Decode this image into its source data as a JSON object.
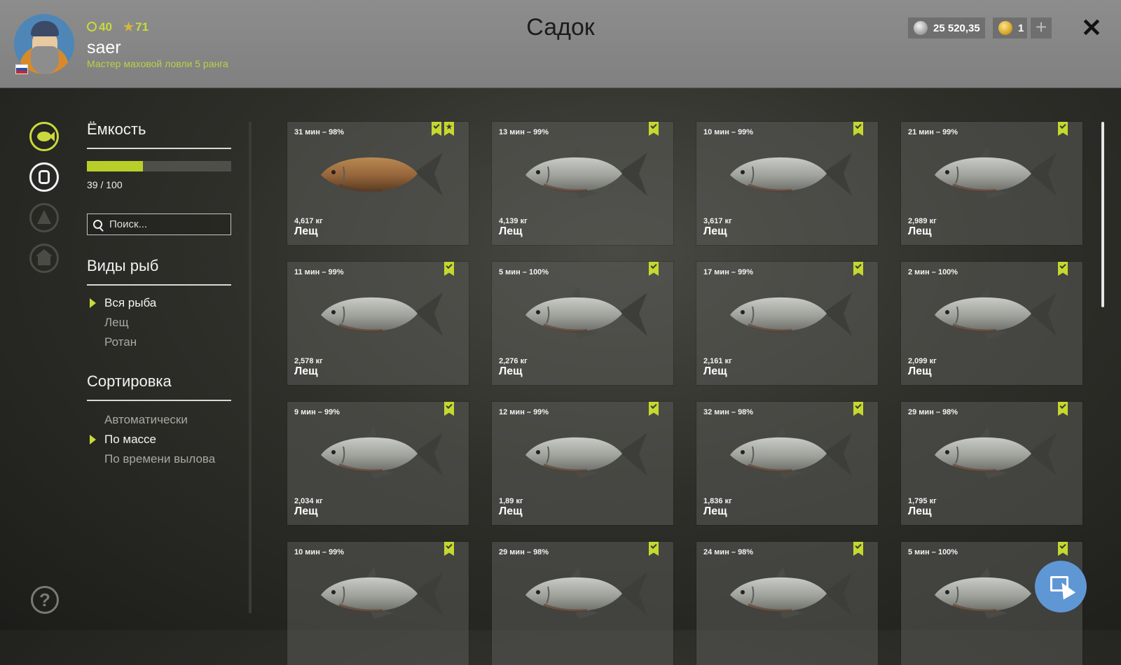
{
  "header": {
    "title": "Садок",
    "level": "40",
    "stars": "71",
    "username": "saer",
    "rank": "Мастер маховой ловли 5 ранга",
    "silver": "25 520,35",
    "gold": "1",
    "plus": "+",
    "close": "✕"
  },
  "colors": {
    "accent": "#c9da3a",
    "bookmark": "#c5d82f",
    "capacity_fill": "#b8cf2a",
    "cursor_button": "#5f97d4"
  },
  "capacity": {
    "title": "Ёмкость",
    "current": 39,
    "max": 100,
    "text": "39 / 100"
  },
  "search": {
    "placeholder": "Поиск..."
  },
  "species": {
    "title": "Виды рыб",
    "items": [
      "Вся рыба",
      "Лещ",
      "Ротан"
    ],
    "selected": 0
  },
  "sort": {
    "title": "Сортировка",
    "items": [
      "Автоматически",
      "По массе",
      "По времени вылова"
    ],
    "selected": 1
  },
  "help": "?",
  "fish": [
    {
      "time": "31 мин – 98%",
      "weight": "4,617 кг",
      "name": "Лещ",
      "bookmark": true,
      "star": true,
      "golden": true
    },
    {
      "time": "13 мин – 99%",
      "weight": "4,139 кг",
      "name": "Лещ",
      "bookmark": true,
      "star": false
    },
    {
      "time": "10 мин – 99%",
      "weight": "3,617 кг",
      "name": "Лещ",
      "bookmark": true,
      "star": false
    },
    {
      "time": "21 мин – 99%",
      "weight": "2,989 кг",
      "name": "Лещ",
      "bookmark": true,
      "star": false
    },
    {
      "time": "11 мин – 99%",
      "weight": "2,578 кг",
      "name": "Лещ",
      "bookmark": true,
      "star": false
    },
    {
      "time": "5 мин – 100%",
      "weight": "2,276 кг",
      "name": "Лещ",
      "bookmark": true,
      "star": false
    },
    {
      "time": "17 мин – 99%",
      "weight": "2,161 кг",
      "name": "Лещ",
      "bookmark": true,
      "star": false
    },
    {
      "time": "2 мин – 100%",
      "weight": "2,099 кг",
      "name": "Лещ",
      "bookmark": true,
      "star": false
    },
    {
      "time": "9 мин – 99%",
      "weight": "2,034 кг",
      "name": "Лещ",
      "bookmark": true,
      "star": false
    },
    {
      "time": "12 мин – 99%",
      "weight": "1,89 кг",
      "name": "Лещ",
      "bookmark": true,
      "star": false
    },
    {
      "time": "32 мин – 98%",
      "weight": "1,836 кг",
      "name": "Лещ",
      "bookmark": true,
      "star": false
    },
    {
      "time": "29 мин – 98%",
      "weight": "1,795 кг",
      "name": "Лещ",
      "bookmark": true,
      "star": false
    },
    {
      "time": "10 мин – 99%",
      "weight": "",
      "name": "",
      "bookmark": true,
      "star": false
    },
    {
      "time": "29 мин – 98%",
      "weight": "",
      "name": "",
      "bookmark": true,
      "star": false
    },
    {
      "time": "24 мин – 98%",
      "weight": "",
      "name": "",
      "bookmark": true,
      "star": false
    },
    {
      "time": "5 мин – 100%",
      "weight": "",
      "name": "",
      "bookmark": true,
      "star": false
    }
  ]
}
